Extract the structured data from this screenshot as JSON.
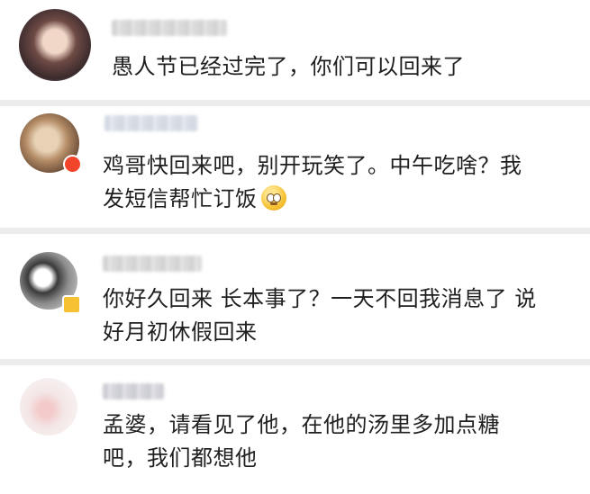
{
  "comments": [
    {
      "text": "愚人节已经过完了，你们可以回来了"
    },
    {
      "text": "鸡哥快回来吧，别开玩笑了。中午吃啥？我\n发短信帮忙订饭",
      "emoji": "pleading-face-emoji"
    },
    {
      "text": "你好久回来 长本事了？一天不回我消息了 说\n好月初休假回来"
    },
    {
      "text": "孟婆，请看见了他，在他的汤里多加点糖\n吧，我们都想他"
    }
  ]
}
